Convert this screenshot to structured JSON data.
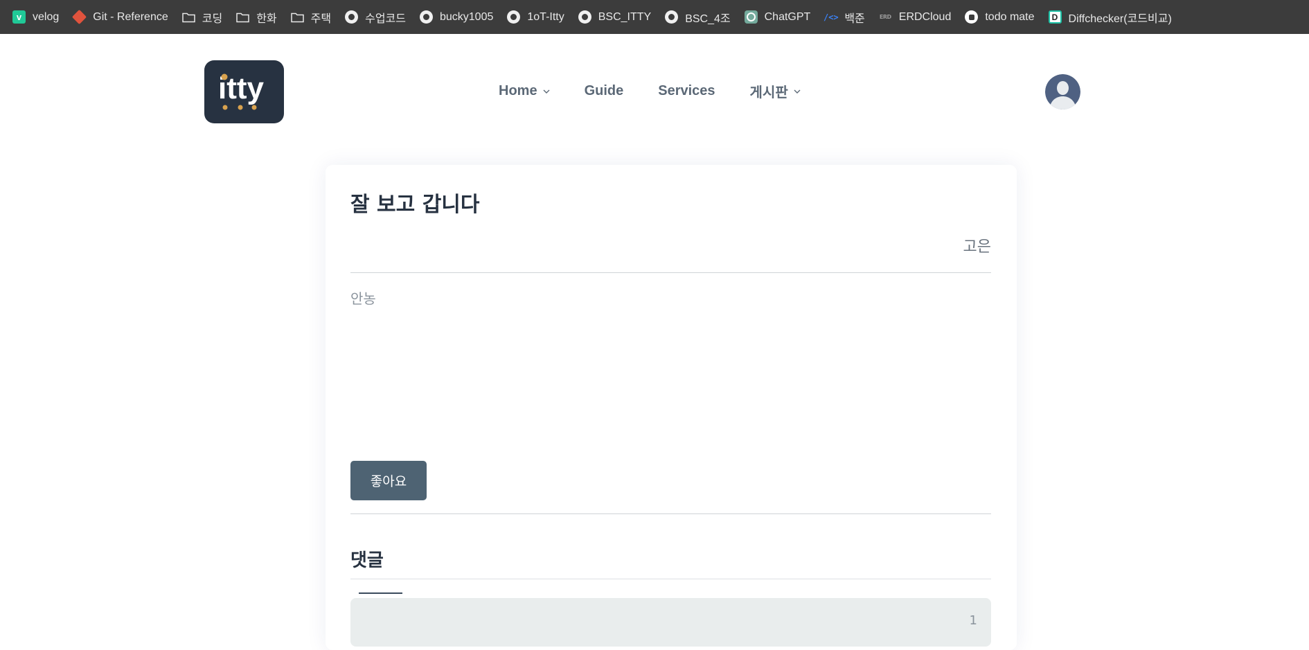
{
  "bookmarks": [
    {
      "label": "velog",
      "icon": "velog-icon"
    },
    {
      "label": "Git - Reference",
      "icon": "git-icon"
    },
    {
      "label": "코딩",
      "icon": "folder-icon"
    },
    {
      "label": "한화",
      "icon": "folder-icon"
    },
    {
      "label": "주택",
      "icon": "folder-icon"
    },
    {
      "label": "수업코드",
      "icon": "github-icon"
    },
    {
      "label": "bucky1005",
      "icon": "github-icon"
    },
    {
      "label": "1oT-Itty",
      "icon": "github-icon"
    },
    {
      "label": "BSC_ITTY",
      "icon": "github-icon"
    },
    {
      "label": "BSC_4조",
      "icon": "github-icon"
    },
    {
      "label": "ChatGPT",
      "icon": "chatgpt-icon"
    },
    {
      "label": "백준",
      "icon": "code-icon"
    },
    {
      "label": "ERDCloud",
      "icon": "erdcloud-icon"
    },
    {
      "label": "todo mate",
      "icon": "todo-icon"
    },
    {
      "label": "Diffchecker(코드비교)",
      "icon": "diffchecker-icon"
    }
  ],
  "header": {
    "logo_text": "itty",
    "nav": {
      "home": "Home",
      "guide": "Guide",
      "services": "Services",
      "board": "게시판"
    }
  },
  "post": {
    "title": "잘 보고 갑니다",
    "author": "고은",
    "body": "안농",
    "like_label": "좋아요"
  },
  "comments": {
    "title": "댓글",
    "count": "1"
  },
  "colors": {
    "bookmark_bar": "#3c3c3c",
    "logo_bg": "#273241",
    "accent": "#4e6373"
  }
}
